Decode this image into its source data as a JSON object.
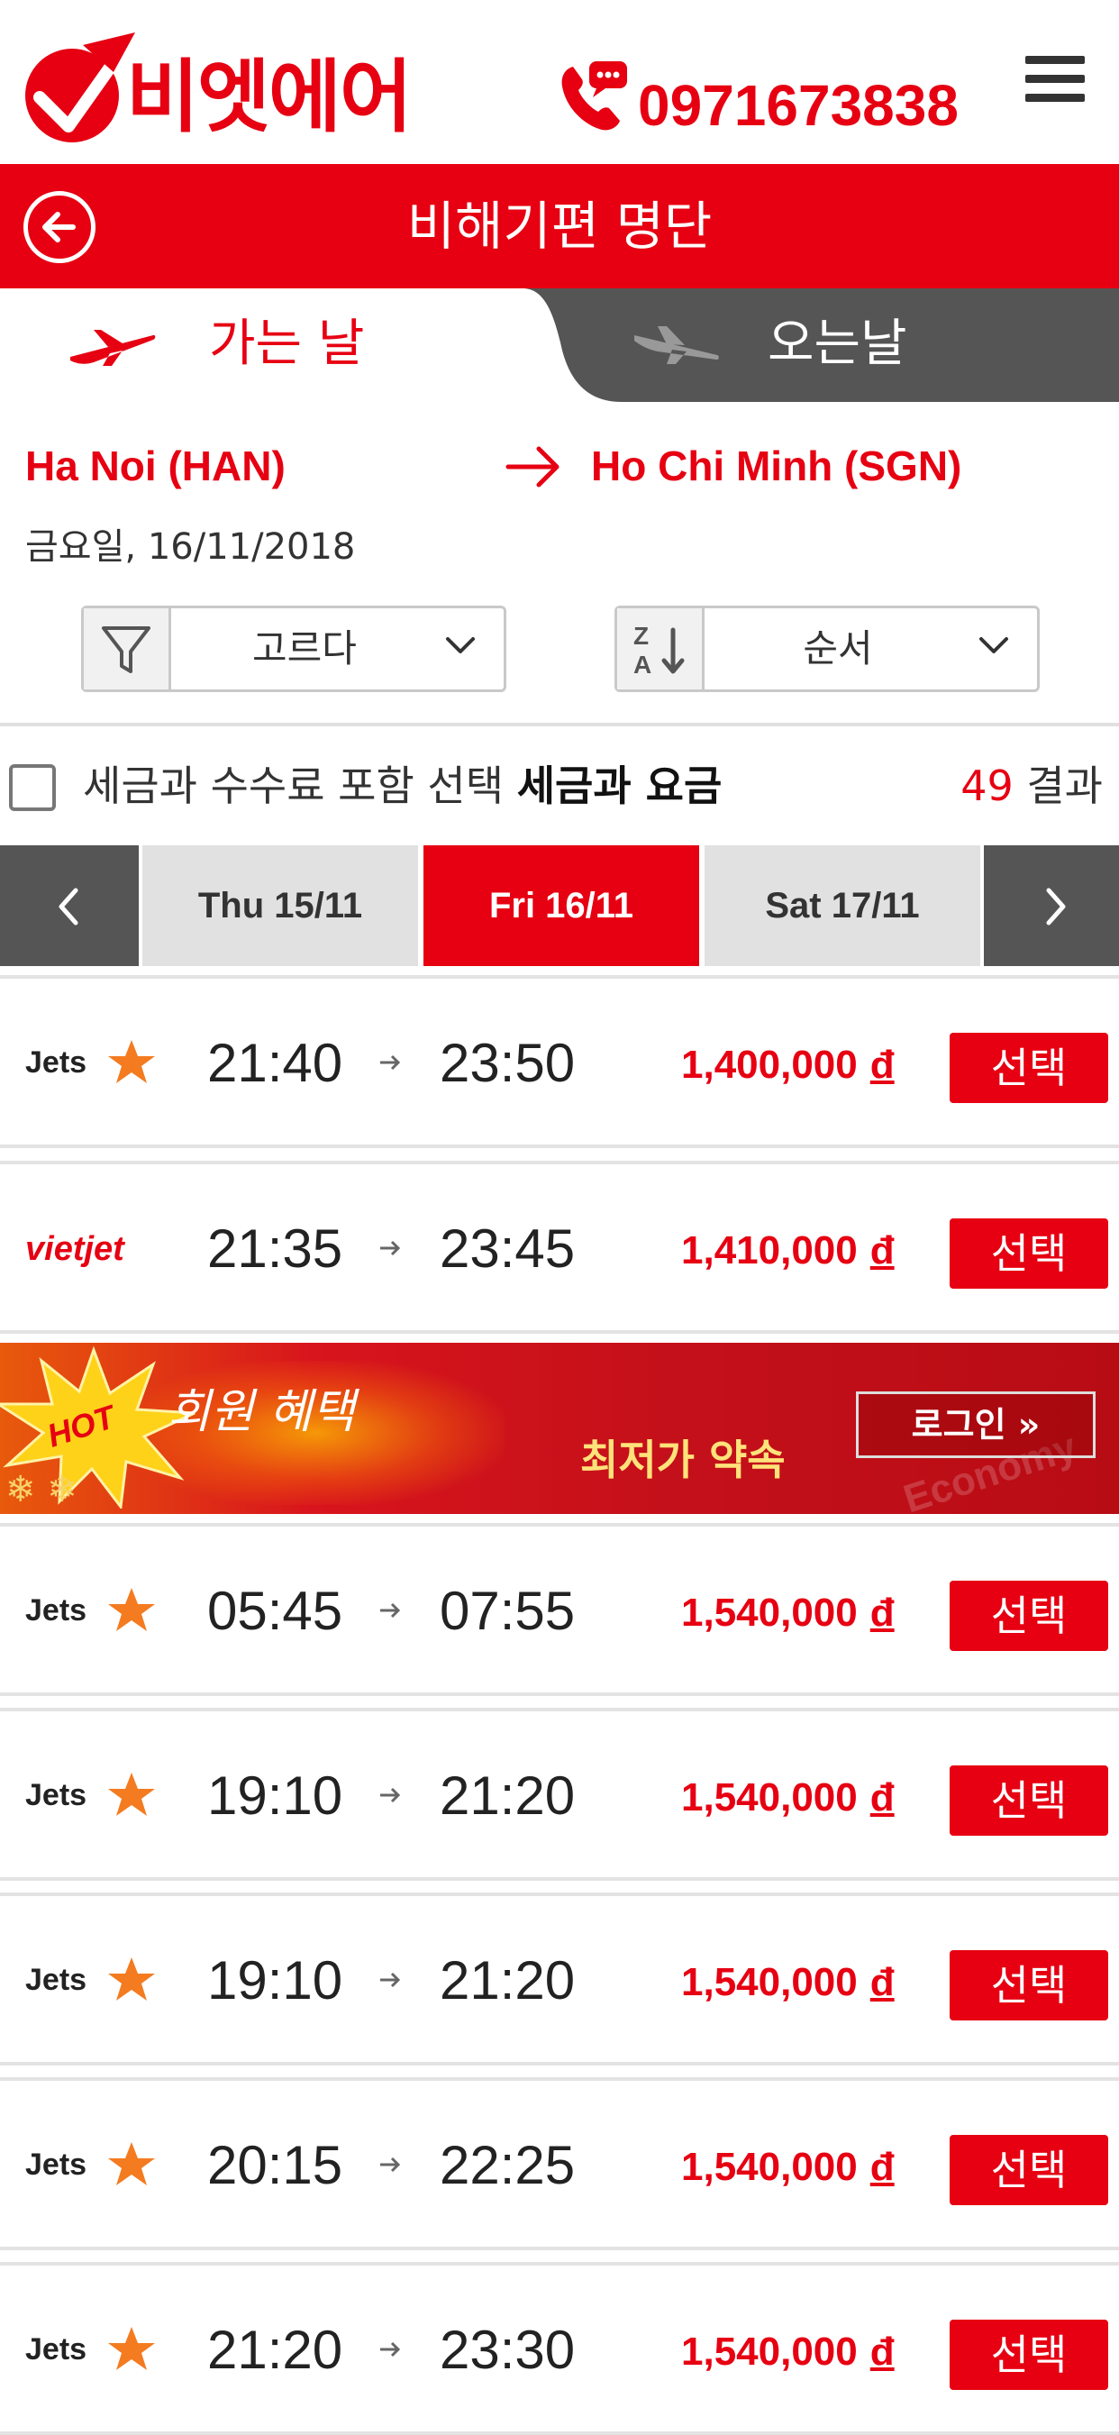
{
  "header": {
    "logo_text": "비엣에어",
    "phone": "0971673838"
  },
  "titlebar": {
    "title": "비해기편 명단"
  },
  "tabs": {
    "depart_label": "가는 날",
    "return_label": "오는날"
  },
  "route": {
    "from": "Ha Noi (HAN)",
    "to": "Ho Chi Minh (SGN)",
    "date": "금요일, 16/11/2018"
  },
  "filters": {
    "filter_label": "고르다",
    "sort_label": "순서"
  },
  "tax_row": {
    "text_plain": "세금과 수수료 포함 선택 ",
    "text_bold": "세금과 요금",
    "result_number": "49",
    "result_word": " 결과"
  },
  "date_bar": {
    "days": [
      "Thu 15/11",
      "Fri 16/11",
      "Sat 17/11"
    ],
    "active": "Fri 16/11"
  },
  "select_label": "선택",
  "currency": "đ",
  "flights": [
    {
      "airline": "Jetstar",
      "dep": "21:40",
      "arr": "23:50",
      "price": "1,400,000"
    },
    {
      "airline": "VietJet",
      "dep": "21:35",
      "arr": "23:45",
      "price": "1,410,000"
    },
    {
      "airline": "Jetstar",
      "dep": "05:45",
      "arr": "07:55",
      "price": "1,540,000"
    },
    {
      "airline": "Jetstar",
      "dep": "19:10",
      "arr": "21:20",
      "price": "1,540,000"
    },
    {
      "airline": "Jetstar",
      "dep": "19:10",
      "arr": "21:20",
      "price": "1,540,000"
    },
    {
      "airline": "Jetstar",
      "dep": "20:15",
      "arr": "22:25",
      "price": "1,540,000"
    },
    {
      "airline": "Jetstar",
      "dep": "21:20",
      "arr": "23:30",
      "price": "1,540,000"
    }
  ],
  "banner": {
    "hot": "HOT",
    "benefit": "회원 혜택",
    "cheapest": "최저가 약속",
    "login": "로그인 »",
    "economy": "Economy"
  },
  "colors": {
    "brand_red": "#e60012",
    "dark_gray": "#555555"
  }
}
